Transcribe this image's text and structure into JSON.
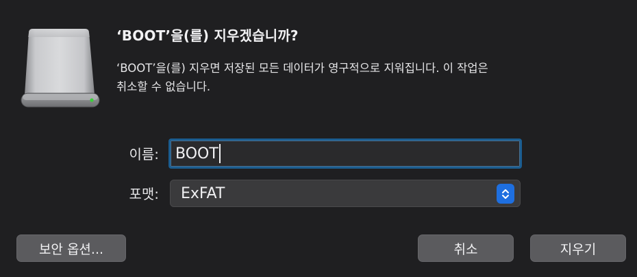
{
  "dialog": {
    "title": "‘BOOT’을(를) 지우겠습니까?",
    "message_line1": "‘BOOT’을(를) 지우면 저장된 모든 데이터가 영구적으로 지워집니다. 이 작업은",
    "message_line2": "취소할 수 없습니다.",
    "icon": "external-drive-icon"
  },
  "form": {
    "name_label": "이름:",
    "name_value": "BOOT",
    "format_label": "포맷:",
    "format_value": "ExFAT"
  },
  "buttons": {
    "security_options": "보안 옵션...",
    "cancel": "취소",
    "erase": "지우기"
  },
  "colors": {
    "background": "#1f1f21",
    "accent": "#1e6fe0",
    "focus_ring": "#1b5d90",
    "button": "#5b5b5e",
    "drive_led": "#3ad13a"
  }
}
